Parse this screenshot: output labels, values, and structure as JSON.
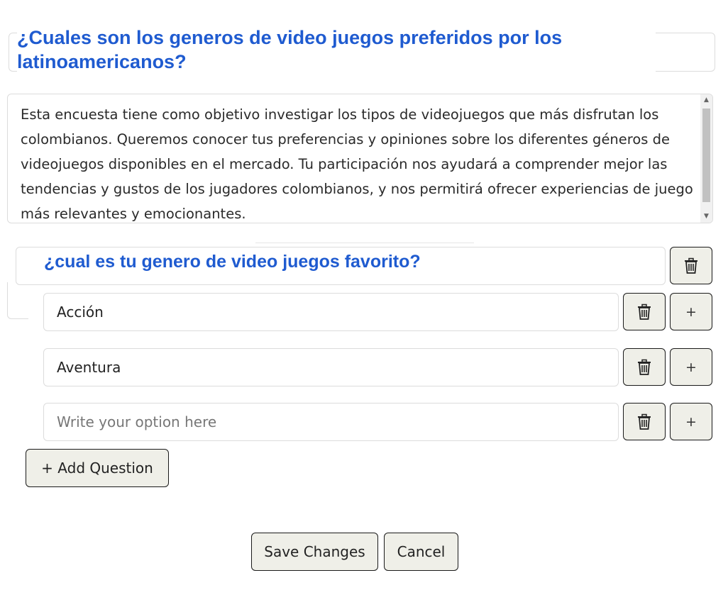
{
  "survey": {
    "title": "¿Cuales son los generos de video juegos preferidos por los latinoamericanos?",
    "description": "Esta encuesta tiene como objetivo investigar los tipos de videojuegos que más disfrutan los colombianos. Queremos conocer tus preferencias y opiniones sobre los diferentes géneros de videojuegos disponibles en el mercado. Tu participación nos ayudará a comprender mejor las tendencias y gustos de los jugadores colombianos, y nos permitirá ofrecer experiencias de juego más relevantes y emocionantes."
  },
  "question": {
    "text": "¿cual es tu genero de video juegos favorito?",
    "options": [
      {
        "value": "Acción"
      },
      {
        "value": "Aventura"
      },
      {
        "value": "",
        "placeholder": "Write your option here"
      }
    ],
    "add_option_label": "+"
  },
  "actions": {
    "add_question_label": "+ Add Question",
    "save_label": "Save Changes",
    "cancel_label": "Cancel"
  },
  "icons": {
    "delete": "trash-icon",
    "add": "plus-icon"
  }
}
